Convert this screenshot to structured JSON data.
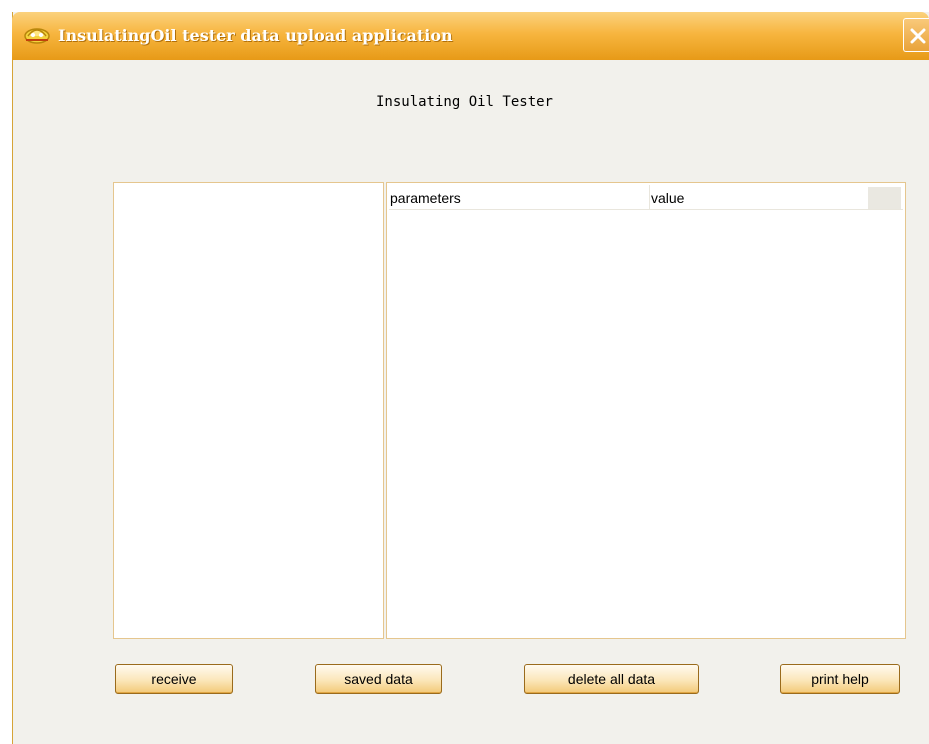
{
  "window": {
    "title": "InsulatingOil tester data upload application"
  },
  "main": {
    "heading": "Insulating Oil Tester"
  },
  "table": {
    "columns": [
      "parameters",
      "value"
    ]
  },
  "buttons": {
    "receive": "receive",
    "saved_data": "saved data",
    "delete_all": "delete all data",
    "print_help": "print help"
  },
  "colors": {
    "title_bar": "#f7b53f",
    "window_bg": "#f2f1ec",
    "panel_border": "#e5c68e",
    "button_face": "#fbe6b9"
  },
  "icons": {
    "app": "app-logo-icon",
    "close": "close-icon"
  }
}
